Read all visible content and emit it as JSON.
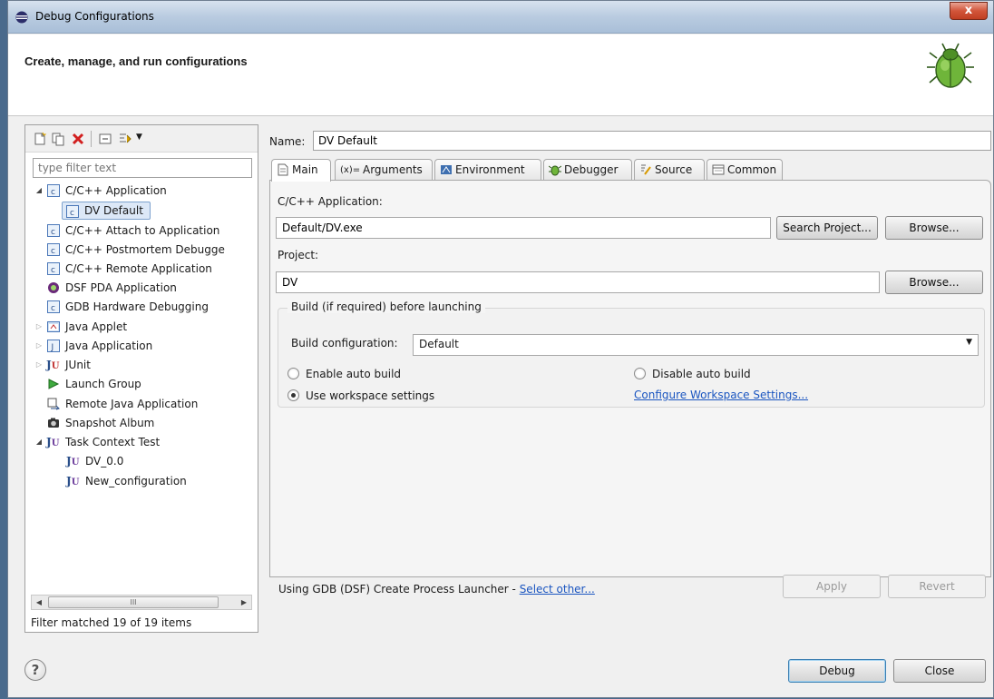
{
  "window": {
    "title": "Debug Configurations",
    "close_label": "x"
  },
  "header": {
    "heading": "Create, manage, and run configurations"
  },
  "left": {
    "filter_placeholder": "type filter text",
    "tree": [
      {
        "label": "C/C++ Application"
      },
      {
        "label": "DV Default"
      },
      {
        "label": "C/C++ Attach to Application"
      },
      {
        "label": "C/C++ Postmortem Debugge"
      },
      {
        "label": "C/C++ Remote Application"
      },
      {
        "label": "DSF PDA Application"
      },
      {
        "label": "GDB Hardware Debugging"
      },
      {
        "label": "Java Applet"
      },
      {
        "label": "Java Application"
      },
      {
        "label": "JUnit"
      },
      {
        "label": "Launch Group"
      },
      {
        "label": "Remote Java Application"
      },
      {
        "label": "Snapshot Album"
      },
      {
        "label": "Task Context Test"
      },
      {
        "label": "DV_0.0"
      },
      {
        "label": "New_configuration"
      }
    ],
    "scroll_grip": "III",
    "status": "Filter matched 19 of 19 items"
  },
  "right": {
    "name_label": "Name:",
    "name_value": "DV Default",
    "tabs": [
      {
        "label": "Main"
      },
      {
        "label": "Arguments"
      },
      {
        "label": "Environment"
      },
      {
        "label": "Debugger"
      },
      {
        "label": "Source"
      },
      {
        "label": "Common"
      }
    ],
    "main": {
      "app_label": "C/C++ Application:",
      "app_value": "Default/DV.exe",
      "search_project": "Search Project...",
      "browse": "Browse...",
      "project_label": "Project:",
      "project_value": "DV",
      "browse2": "Browse...",
      "build_group_title": "Build (if required) before launching",
      "build_config_label": "Build configuration:",
      "build_config_value": "Default",
      "enable_auto_build": "Enable auto build",
      "disable_auto_build": "Disable auto build",
      "use_workspace": "Use workspace settings",
      "configure_workspace": "Configure Workspace Settings..."
    },
    "launcher_prefix": "Using GDB (DSF) Create Process Launcher - ",
    "launcher_link": "Select other...",
    "apply": "Apply",
    "revert": "Revert"
  },
  "bottom": {
    "help": "?",
    "debug": "Debug",
    "close": "Close"
  }
}
